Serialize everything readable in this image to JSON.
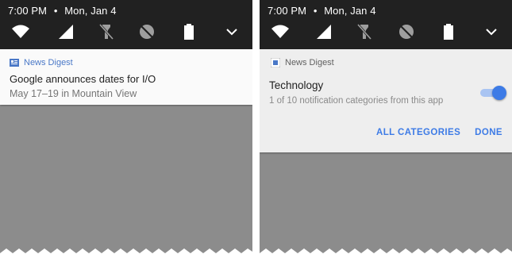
{
  "left": {
    "status_bar": {
      "time": "7:00 PM",
      "separator": "•",
      "date": "Mon, Jan 4"
    },
    "quick_settings": [
      "wifi-icon",
      "signal-icon",
      "flashlight-off-icon",
      "do-not-disturb-icon",
      "battery-icon",
      "chevron-down-icon"
    ],
    "notification": {
      "app_name": "News Digest",
      "title": "Google announces dates for I/O",
      "text": "May 17–19 in Mountain View"
    }
  },
  "right": {
    "status_bar": {
      "time": "7:00 PM",
      "separator": "•",
      "date": "Mon, Jan 4"
    },
    "quick_settings": [
      "wifi-icon",
      "signal-icon",
      "flashlight-off-icon",
      "do-not-disturb-icon",
      "battery-icon",
      "chevron-down-icon"
    ],
    "settings": {
      "app_name": "News Digest",
      "category": "Technology",
      "subtitle": "1 of 10 notification categories from this app",
      "toggle_on": true,
      "all_categories_label": "ALL CATEGORIES",
      "done_label": "DONE"
    }
  },
  "colors": {
    "status_bar": "#212121",
    "accent": "#3d7be6",
    "background": "#8c8c8c"
  }
}
